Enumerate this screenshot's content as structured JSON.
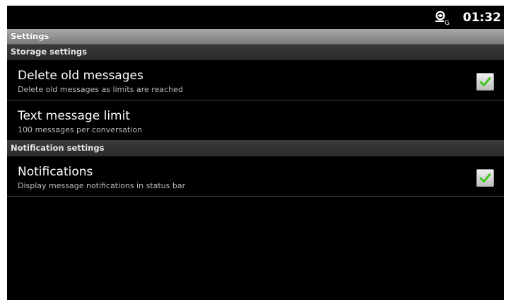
{
  "status_bar": {
    "time": "01:32",
    "network_icon": "signal-globe-icon"
  },
  "title_bar": {
    "title": "Settings"
  },
  "sections": [
    {
      "header": "Storage settings",
      "items": [
        {
          "title": "Delete old messages",
          "summary": "Delete old messages as limits are reached",
          "checkbox": true,
          "checked": true
        },
        {
          "title": "Text message limit",
          "summary": "100 messages per conversation",
          "checkbox": false
        }
      ]
    },
    {
      "header": "Notification settings",
      "items": [
        {
          "title": "Notifications",
          "summary": "Display message notifications in status bar",
          "checkbox": true,
          "checked": true
        }
      ]
    }
  ],
  "colors": {
    "background": "#000000",
    "check_green": "#3fc71d",
    "title_bar": "#8f8f8f",
    "section_header": "#333333"
  }
}
